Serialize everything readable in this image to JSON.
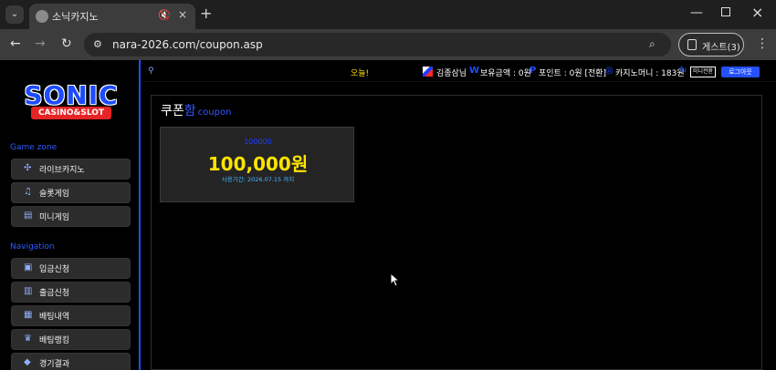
{
  "browser": {
    "tab_title": "소닉카지노",
    "url": "nara-2026.com/coupon.asp",
    "guest_label": "게스트(3)"
  },
  "site": {
    "logo_top": "SONIC",
    "logo_bottom": "CASINO&SLOT",
    "game_zone_label": "Game zone",
    "navigation_label": "Navigation",
    "game_menu": [
      {
        "label": "라이브카지노",
        "icon": "casino-chip-icon"
      },
      {
        "label": "슬롯게임",
        "icon": "slot-icon"
      },
      {
        "label": "미니게임",
        "icon": "mini-game-icon"
      }
    ],
    "nav_menu": [
      {
        "label": "입금신청",
        "icon": "deposit-icon"
      },
      {
        "label": "출금신청",
        "icon": "withdraw-icon"
      },
      {
        "label": "배팅내역",
        "icon": "history-icon"
      },
      {
        "label": "배팅랭킹",
        "icon": "ranking-icon"
      },
      {
        "label": "경기결과",
        "icon": "result-icon"
      }
    ],
    "topbar": {
      "today": "오늘!",
      "user_name": "김종삼님",
      "balance_prefix": "W",
      "balance_text": "보유금액 : 0원",
      "point_prefix": "P",
      "point_text": "포인트 : 0원 [전환]",
      "casino_text": "카지노머니 : 183원",
      "minigame_button": "미니전환",
      "logout_button": "로그아웃"
    },
    "content": {
      "title_main": "쿠폰",
      "title_accent": "함",
      "title_sub": "coupon",
      "coupon": {
        "name": "100000",
        "amount": "100,000원",
        "expire": "사용기간: 2026.07.15 까지"
      }
    }
  },
  "colors": {
    "accent": "#1f4fff",
    "amount": "#ffe400",
    "expire": "#47b7ff"
  }
}
